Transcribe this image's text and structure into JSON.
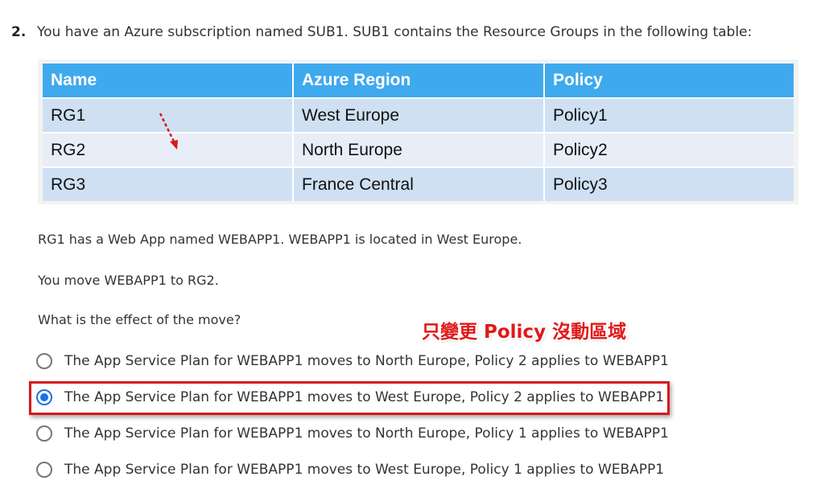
{
  "question": {
    "number": "2.",
    "text": "You have an Azure subscription named SUB1.  SUB1 contains the Resource Groups in the following table:"
  },
  "table": {
    "headers": [
      "Name",
      "Azure Region",
      "Policy"
    ],
    "rows": [
      [
        "RG1",
        "West Europe",
        "Policy1"
      ],
      [
        "RG2",
        "North Europe",
        "Policy2"
      ],
      [
        "RG3",
        "France Central",
        "Policy3"
      ]
    ]
  },
  "paragraphs": [
    "RG1 has a Web App named WEBAPP1.  WEBAPP1 is located in West Europe.",
    "You move WEBAPP1 to RG2.",
    "What is the effect of the move?"
  ],
  "annotation": "只變更 Policy 沒動區域",
  "options": [
    {
      "label": "The App Service Plan for WEBAPP1 moves to North Europe, Policy 2 applies to WEBAPP1",
      "selected": false
    },
    {
      "label": "The App Service Plan for WEBAPP1 moves to West Europe, Policy 2 applies to WEBAPP1",
      "selected": true
    },
    {
      "label": "The App Service Plan for WEBAPP1 moves to North Europe, Policy 1 applies to WEBAPP1",
      "selected": false
    },
    {
      "label": "The App Service Plan for WEBAPP1 moves to West Europe, Policy 1 applies to WEBAPP1",
      "selected": false
    }
  ],
  "colors": {
    "header_bg": "#3fa9ee",
    "row_odd": "#cfe0f3",
    "row_even": "#e8eef8",
    "highlight": "#d7191c",
    "radio_selected": "#1a73e8"
  },
  "icons": {
    "annotation_arrow": "dashed-arrow-icon"
  }
}
